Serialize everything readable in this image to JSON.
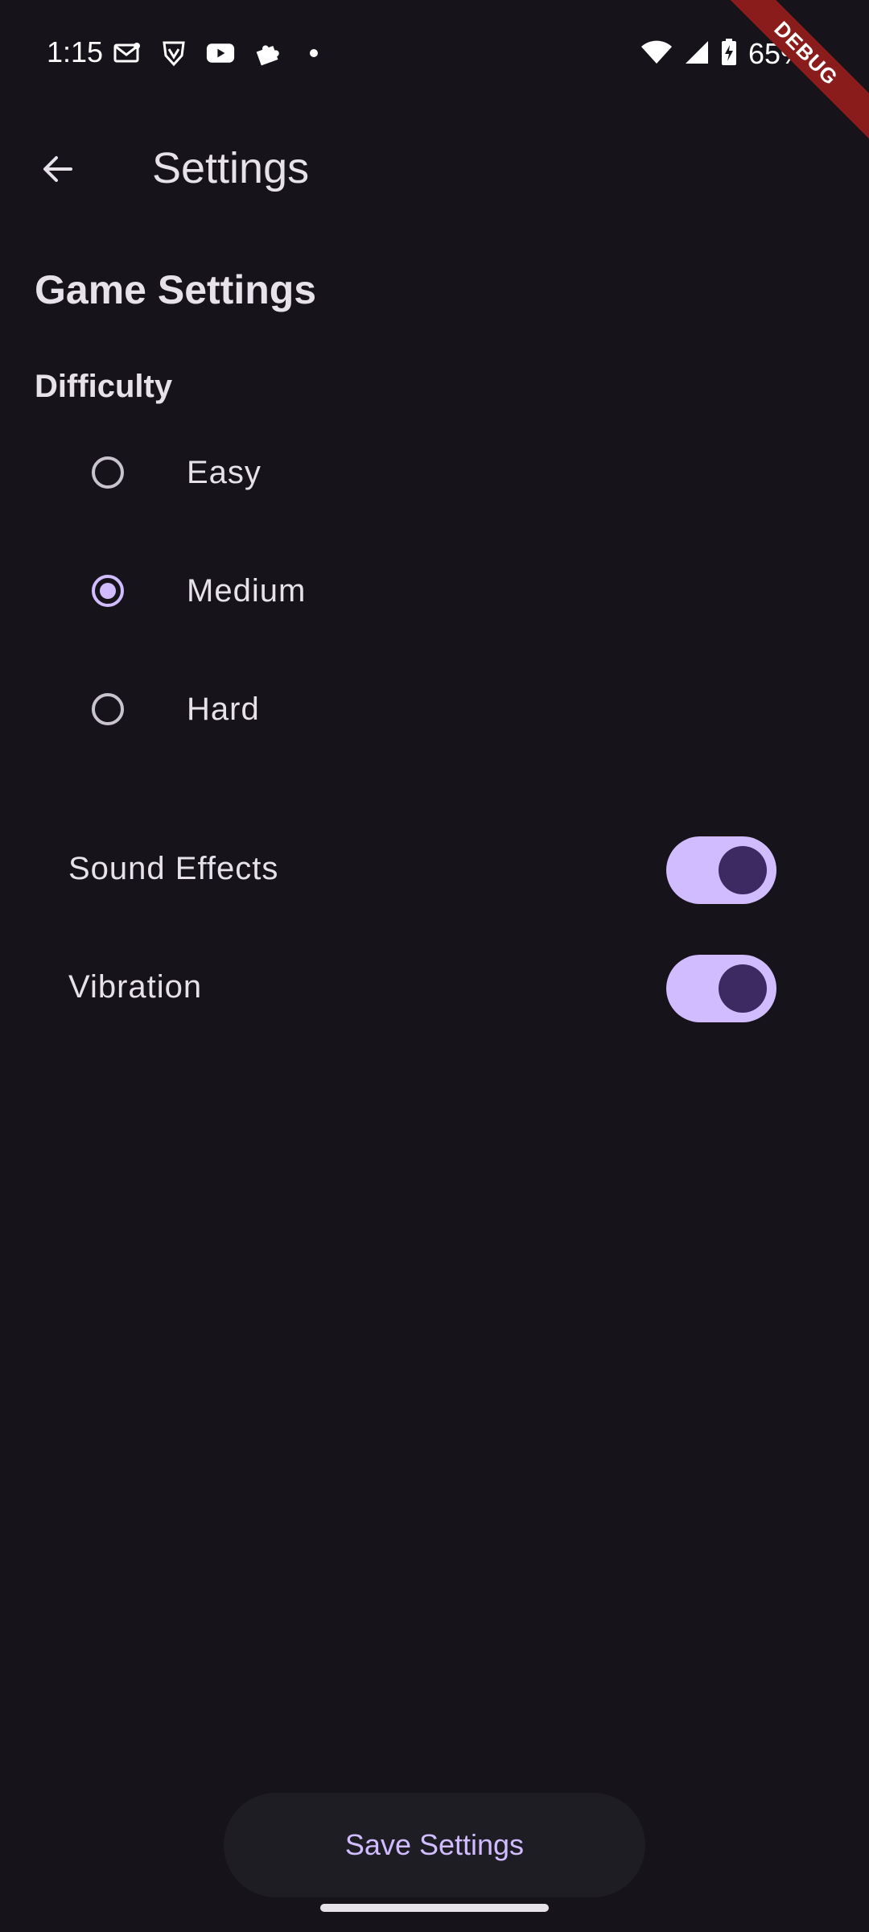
{
  "status_bar": {
    "time": "1:15",
    "battery": "65%",
    "left_icons": [
      "gmail-icon",
      "brave-icon",
      "youtube-icon",
      "puzzle-icon",
      "dot-icon"
    ],
    "right_icons": [
      "wifi-icon",
      "signal-icon",
      "battery-charging-icon"
    ]
  },
  "debug_banner": "DEBUG",
  "app_bar": {
    "title": "Settings",
    "back_icon": "arrow-back-icon"
  },
  "content": {
    "section_title": "Game Settings",
    "difficulty": {
      "label": "Difficulty",
      "options": [
        {
          "label": "Easy",
          "selected": false
        },
        {
          "label": "Medium",
          "selected": true
        },
        {
          "label": "Hard",
          "selected": false
        }
      ]
    },
    "toggles": [
      {
        "label": "Sound Effects",
        "on": true
      },
      {
        "label": "Vibration",
        "on": true
      }
    ]
  },
  "save_button": {
    "label": "Save Settings"
  },
  "colors": {
    "background": "#16141a",
    "accent": "#d0bcff",
    "switch_thumb": "#3d2a63",
    "text": "#e7e1ea",
    "debug_ribbon": "#8b1c1c"
  }
}
